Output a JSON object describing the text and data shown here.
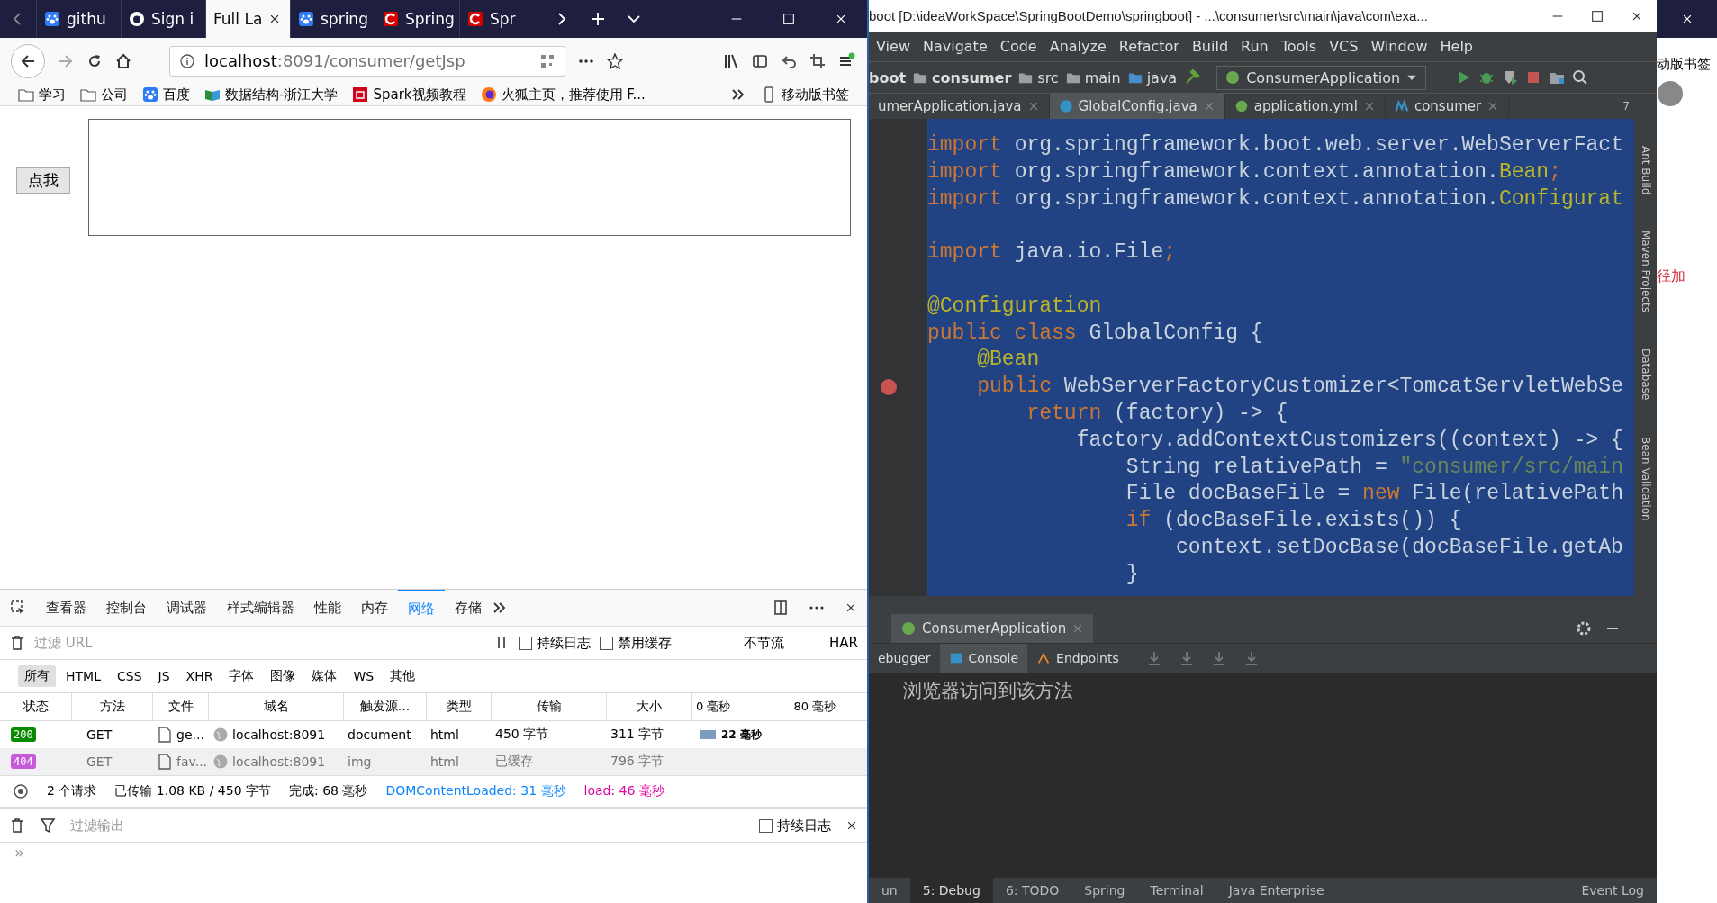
{
  "browser": {
    "tabs": [
      {
        "label": "githu",
        "selected": false
      },
      {
        "label": "Sign i",
        "selected": false
      },
      {
        "label": "Full La",
        "selected": true
      },
      {
        "label": "spring",
        "selected": false
      },
      {
        "label": "Spring",
        "selected": false
      },
      {
        "label": "Spr",
        "selected": false
      }
    ],
    "url_host": "localhost",
    "url_rest": ":8091/consumer/getJsp",
    "bookmarks": [
      "学习",
      "公司",
      "百度",
      "数据结构-浙江大学",
      "Spark视频教程",
      "火狐主页，推荐使用 F..."
    ],
    "mobile_bookmarks": "移动版书签",
    "page_button": "点我"
  },
  "devtools": {
    "tools": [
      {
        "label": "查看器",
        "selected": false
      },
      {
        "label": "控制台",
        "selected": false
      },
      {
        "label": "调试器",
        "selected": false
      },
      {
        "label": "样式编辑器",
        "selected": false
      },
      {
        "label": "性能",
        "selected": false
      },
      {
        "label": "内存",
        "selected": false
      },
      {
        "label": "网络",
        "selected": true
      },
      {
        "label": "存储",
        "selected": false
      }
    ],
    "filter_placeholder": "过滤 URL",
    "options": [
      {
        "label": "持续日志",
        "checked": false
      },
      {
        "label": "禁用缓存",
        "checked": false
      }
    ],
    "throttle": "不节流",
    "har": "HAR",
    "type_filters": [
      {
        "label": "所有",
        "selected": true
      },
      {
        "label": "HTML",
        "selected": false
      },
      {
        "label": "CSS",
        "selected": false
      },
      {
        "label": "JS",
        "selected": false
      },
      {
        "label": "XHR",
        "selected": false
      },
      {
        "label": "字体",
        "selected": false
      },
      {
        "label": "图像",
        "selected": false
      },
      {
        "label": "媒体",
        "selected": false
      },
      {
        "label": "WS",
        "selected": false
      },
      {
        "label": "其他",
        "selected": false
      }
    ],
    "columns": [
      "状态",
      "方法",
      "文件",
      "域名",
      "触发源...",
      "类型",
      "传输",
      "大小"
    ],
    "timeline_ticks": [
      "0 毫秒",
      "80 毫秒"
    ],
    "rows": [
      {
        "status": "200",
        "color": "#058b00",
        "method": "GET",
        "file": "ge...",
        "domain": "localhost:8091",
        "cause": "document",
        "type": "html",
        "transfer": "450 字节",
        "size": "311 字节",
        "timing": "22 毫秒"
      },
      {
        "status": "404",
        "color": "#c65ad9",
        "method": "GET",
        "file": "fav...",
        "domain": "localhost:8091",
        "cause": "img",
        "type": "html",
        "transfer": "已缓存",
        "size": "796 字节"
      }
    ],
    "summary": {
      "requests": "2 个请求",
      "transferred": "已传输 1.08 KB / 450 字节",
      "finish": "完成:  68 毫秒",
      "dom_loaded": "DOMContentLoaded: 31 毫秒",
      "load": "load: 46 毫秒"
    },
    "console_placeholder": "过滤输出",
    "console_option": {
      "label": "持续日志",
      "checked": false
    },
    "prompt": "»"
  },
  "ide": {
    "title": "boot [D:\\ideaWorkSpace\\SpringBootDemo\\springboot] - ...\\consumer\\src\\main\\java\\com\\exa...",
    "menu": [
      "View",
      "Navigate",
      "Code",
      "Analyze",
      "Refactor",
      "Build",
      "Run",
      "Tools",
      "VCS",
      "Window",
      "Help"
    ],
    "breadcrumbs": [
      "boot",
      "consumer",
      "src",
      "main",
      "java"
    ],
    "run_config": "ConsumerApplication",
    "editor_tabs": [
      {
        "label": "umerApplication.java",
        "selected": false
      },
      {
        "label": "GlobalConfig.java",
        "selected": true
      },
      {
        "label": "application.yml",
        "selected": false
      },
      {
        "label": "consumer",
        "selected": false
      }
    ],
    "tab_count": "7",
    "code": [
      {
        "tokens": [
          {
            "text": "import",
            "kind": "keyword"
          },
          {
            "text": " org.springframework.boot.web.server.WebServerFact",
            "kind": "plain"
          }
        ]
      },
      {
        "tokens": [
          {
            "text": "import",
            "kind": "keyword"
          },
          {
            "text": " org.springframework.context.annotation.",
            "kind": "plain"
          },
          {
            "text": "Bean",
            "kind": "annotation"
          },
          {
            "text": ";",
            "kind": "keyword"
          }
        ]
      },
      {
        "tokens": [
          {
            "text": "import",
            "kind": "keyword"
          },
          {
            "text": " org.springframework.context.annotation.",
            "kind": "plain"
          },
          {
            "text": "Configurat",
            "kind": "annotation"
          }
        ]
      },
      {
        "blank_before": true,
        "tokens": [
          {
            "text": "import",
            "kind": "keyword"
          },
          {
            "text": " java.io.File",
            "kind": "plain"
          },
          {
            "text": ";",
            "kind": "keyword"
          }
        ]
      },
      {
        "blank_before": true,
        "tokens": [
          {
            "text": "@Configuration",
            "kind": "annotation"
          }
        ]
      },
      {
        "tokens": [
          {
            "text": "public class",
            "kind": "keyword"
          },
          {
            "text": " GlobalConfig {",
            "kind": "plain"
          }
        ]
      },
      {
        "tokens": [
          {
            "text": "    @Bean",
            "kind": "annotation"
          }
        ]
      },
      {
        "tokens": [
          {
            "text": "    public",
            "kind": "keyword"
          },
          {
            "text": " WebServerFactoryCustomizer<TomcatServletWebSe",
            "kind": "plain"
          }
        ]
      },
      {
        "tokens": [
          {
            "text": "        return",
            "kind": "keyword"
          },
          {
            "text": " (factory) -> {",
            "kind": "plain"
          }
        ]
      },
      {
        "tokens": [
          {
            "text": "            factory.addContextCustomizers((context) -> {",
            "kind": "plain"
          }
        ]
      },
      {
        "tokens": [
          {
            "text": "                String relativePath = ",
            "kind": "plain"
          },
          {
            "text": "\"consumer/src/main",
            "kind": "string"
          }
        ]
      },
      {
        "tokens": [
          {
            "text": "                File docBaseFile = ",
            "kind": "plain"
          },
          {
            "text": "new",
            "kind": "keyword"
          },
          {
            "text": " File(relativePath",
            "kind": "plain"
          }
        ]
      },
      {
        "tokens": [
          {
            "text": "                if",
            "kind": "keyword"
          },
          {
            "text": " (docBaseFile.exists()) {",
            "kind": "plain"
          }
        ]
      },
      {
        "tokens": [
          {
            "text": "                    context.setDocBase(docBaseFile.getAb",
            "kind": "plain"
          }
        ]
      },
      {
        "tokens": [
          {
            "text": "                }",
            "kind": "plain"
          }
        ]
      }
    ],
    "tool_windows": [
      "Ant Build",
      "Maven Projects",
      "Database",
      "Bean Validation"
    ],
    "run_tab": "ConsumerApplication",
    "run_subtabs": [
      {
        "label": "ebugger",
        "selected": false
      },
      {
        "label": "Console",
        "selected": true
      },
      {
        "label": "Endpoints",
        "selected": false
      }
    ],
    "console_output": "浏览器访问到该方法",
    "bottom_tabs": [
      {
        "label": "un",
        "selected": false
      },
      {
        "label": "5: Debug",
        "selected": true
      },
      {
        "label": "6: TODO",
        "selected": false
      },
      {
        "label": "Spring",
        "selected": false
      },
      {
        "label": "Terminal",
        "selected": false
      },
      {
        "label": "Java Enterprise",
        "selected": false
      }
    ],
    "event_log": "Event Log"
  },
  "background_page": {
    "bookmark": "动版书签",
    "snippet": "径加"
  }
}
